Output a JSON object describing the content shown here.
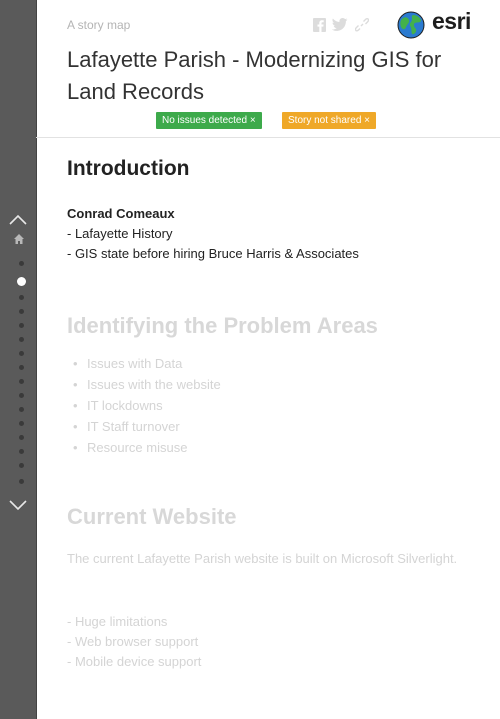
{
  "header": {
    "kicker": "A story map",
    "logo_text": "esri",
    "title": "Lafayette Parish - Modernizing GIS for Land Records",
    "badges": {
      "issues": "No issues detected ×",
      "shared": "Story not shared ×"
    }
  },
  "nav": {
    "up_icon": "chevron-up-icon",
    "down_icon": "chevron-down-icon",
    "home_icon": "home-icon",
    "dot_count": 15,
    "active_index": 1
  },
  "sections": {
    "intro": {
      "heading": "Introduction",
      "author": "Conrad Comeaux",
      "lines": [
        "- Lafayette History",
        "- GIS state before hiring Bruce Harris & Associates"
      ]
    },
    "problems": {
      "heading": "Identifying the Problem Areas",
      "items": [
        "Issues with Data",
        "Issues with the website",
        "IT lockdowns",
        "IT Staff turnover",
        "Resource misuse"
      ]
    },
    "website": {
      "heading": "Current Website",
      "paragraph": "The current Lafayette Parish website is built on Microsoft Silverlight.",
      "lines": [
        "- Huge limitations",
        "- Web browser support",
        "- Mobile device support"
      ]
    }
  },
  "colors": {
    "rail": "#5a5a5a",
    "badge_green": "#3daa4b",
    "badge_orange": "#efa828",
    "dim_text": "#d4d4d4"
  }
}
